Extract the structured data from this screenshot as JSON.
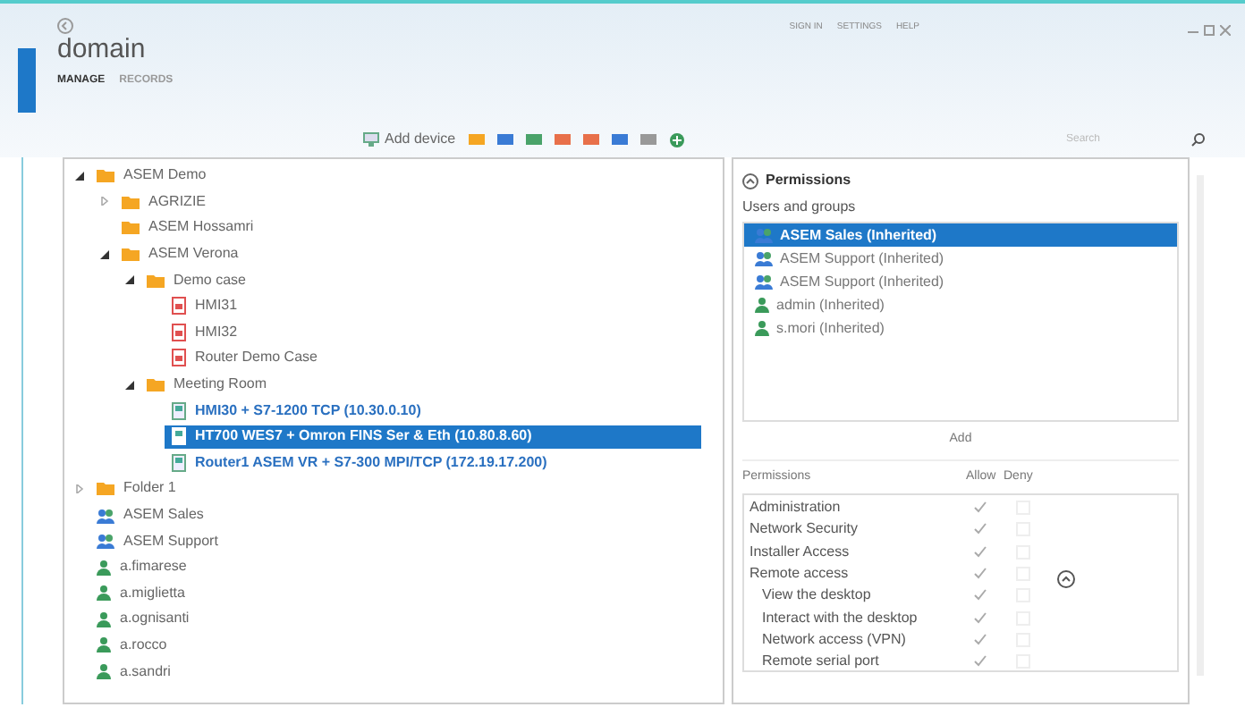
{
  "top_links": [
    "SIGN IN",
    "SETTINGS",
    "HELP"
  ],
  "title": "domain",
  "nav_tabs": [
    {
      "label": "MANAGE",
      "selected": true
    },
    {
      "label": "RECORDS",
      "selected": false
    }
  ],
  "toolbar": {
    "add_device": "Add device",
    "search": {
      "placeholder": "Search"
    }
  },
  "tree": [
    {
      "label": "ASEM Demo",
      "kind": "folder",
      "expanded": true,
      "selected": false,
      "children": [
        {
          "label": "AGRIZIE",
          "kind": "folder",
          "expanded": false,
          "selected": false
        },
        {
          "label": "ASEM Hossamri",
          "kind": "folder",
          "selected": false
        },
        {
          "label": "ASEM Verona",
          "kind": "folder",
          "expanded": true,
          "selected": false,
          "children": [
            {
              "label": "Demo case",
              "kind": "folder",
              "expanded": true,
              "selected": false,
              "children": [
                {
                  "label": "HMI31",
                  "kind": "device",
                  "selected": false
                },
                {
                  "label": "HMI32",
                  "kind": "device",
                  "selected": false
                },
                {
                  "label": "Router Demo Case",
                  "kind": "device",
                  "selected": false
                }
              ]
            },
            {
              "label": "Meeting Room",
              "kind": "folder",
              "expanded": true,
              "selected": false,
              "children": [
                {
                  "label": "HMI30 + S7-1200 TCP (10.30.0.10)",
                  "kind": "online",
                  "selected": false
                },
                {
                  "label": "HT700 WES7 + Omron FINS Ser & Eth (10.80.8.60)",
                  "kind": "online",
                  "selected": true
                },
                {
                  "label": "Router1 ASEM VR + S7-300 MPI/TCP (172.19.17.200)",
                  "kind": "online",
                  "selected": false
                }
              ]
            }
          ]
        }
      ]
    },
    {
      "label": "Folder 1",
      "kind": "folder",
      "expanded": false,
      "selected": false
    },
    {
      "label": "ASEM Sales",
      "kind": "group",
      "selected": false
    },
    {
      "label": "ASEM Support",
      "kind": "group",
      "selected": false
    },
    {
      "label": "a.fimarese",
      "kind": "user",
      "selected": false
    },
    {
      "label": "a.miglietta",
      "kind": "user",
      "selected": false
    },
    {
      "label": "a.ognisanti",
      "kind": "user",
      "selected": false
    },
    {
      "label": "a.rocco",
      "kind": "user",
      "selected": false
    },
    {
      "label": "a.sandri",
      "kind": "user",
      "selected": false
    }
  ],
  "permissions_panel": {
    "title": "Permissions",
    "users_label": "Users and groups",
    "users": [
      {
        "label": "ASEM Sales (Inherited)",
        "kind": "group",
        "selected": true
      },
      {
        "label": "ASEM Support (Inherited)",
        "kind": "group",
        "selected": false
      },
      {
        "label": "ASEM Support (Inherited)",
        "kind": "group",
        "selected": false
      },
      {
        "label": "admin (Inherited)",
        "kind": "user",
        "selected": false
      },
      {
        "label": "s.mori (Inherited)",
        "kind": "user",
        "selected": false
      }
    ],
    "add_button": "Add",
    "columns": [
      "Permissions",
      "Allow",
      "Deny"
    ],
    "rows": [
      {
        "label": "Administration",
        "sub": false,
        "allow": true,
        "deny": false
      },
      {
        "label": "Network Security",
        "sub": false,
        "allow": true,
        "deny": false
      },
      {
        "label": "Installer Access",
        "sub": false,
        "allow": true,
        "deny": false
      },
      {
        "label": "Remote access",
        "sub": false,
        "allow": true,
        "deny": false
      },
      {
        "label": "View the desktop",
        "sub": true,
        "allow": true,
        "deny": false
      },
      {
        "label": "Interact with the desktop",
        "sub": true,
        "allow": true,
        "deny": false
      },
      {
        "label": "Network access (VPN)",
        "sub": true,
        "allow": true,
        "deny": false
      },
      {
        "label": "Remote serial port",
        "sub": true,
        "allow": true,
        "deny": false
      }
    ]
  }
}
